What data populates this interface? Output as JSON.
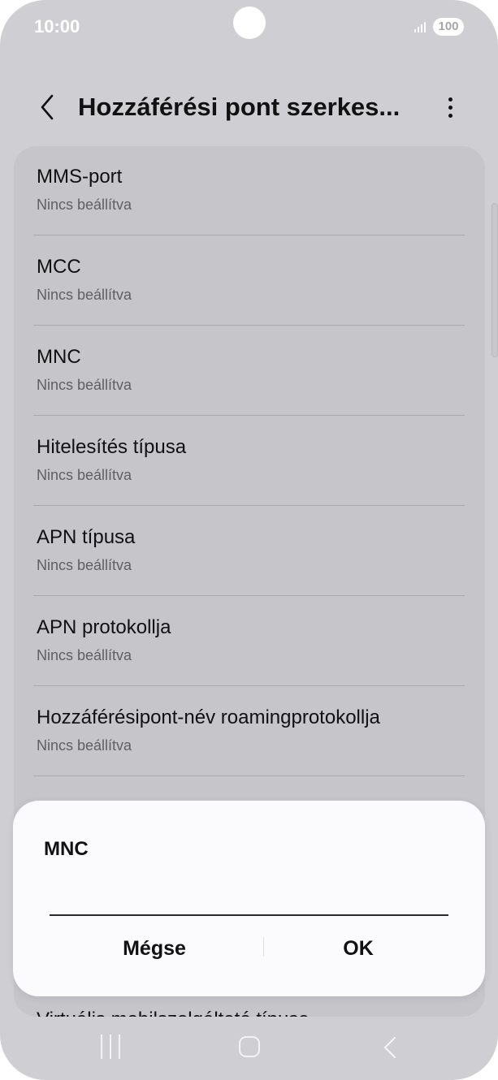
{
  "status_bar": {
    "time": "10:00",
    "battery": "100",
    "icons": [
      "signal-icon",
      "battery-icon"
    ]
  },
  "header": {
    "title": "Hozzáférési pont szerkes...",
    "back_icon": "chevron-left-icon",
    "more_icon": "more-vert-icon"
  },
  "settings": [
    {
      "label": "MMS-port",
      "value": "Nincs beállítva"
    },
    {
      "label": "MCC",
      "value": "Nincs beállítva"
    },
    {
      "label": "MNC",
      "value": "Nincs beállítva"
    },
    {
      "label": "Hitelesítés típusa",
      "value": "Nincs beállítva"
    },
    {
      "label": "APN típusa",
      "value": "Nincs beállítva"
    },
    {
      "label": "APN protokollja",
      "value": "Nincs beállítva"
    },
    {
      "label": "Hozzáférésipont-név roamingprotokollja",
      "value": "Nincs beállítva"
    },
    {
      "label": "Virtuális mobilszolgáltató típusa",
      "value": ""
    }
  ],
  "dialog": {
    "title": "MNC",
    "input_value": "",
    "cancel_label": "Mégse",
    "ok_label": "OK"
  },
  "nav_bar": {
    "icons": [
      "recents-icon",
      "home-icon",
      "back-icon"
    ]
  },
  "colors": {
    "dim_background": "#cfcfd3",
    "dialog_background": "#fbfbfe",
    "text_primary": "#111111",
    "text_secondary": "#5f5f64"
  }
}
